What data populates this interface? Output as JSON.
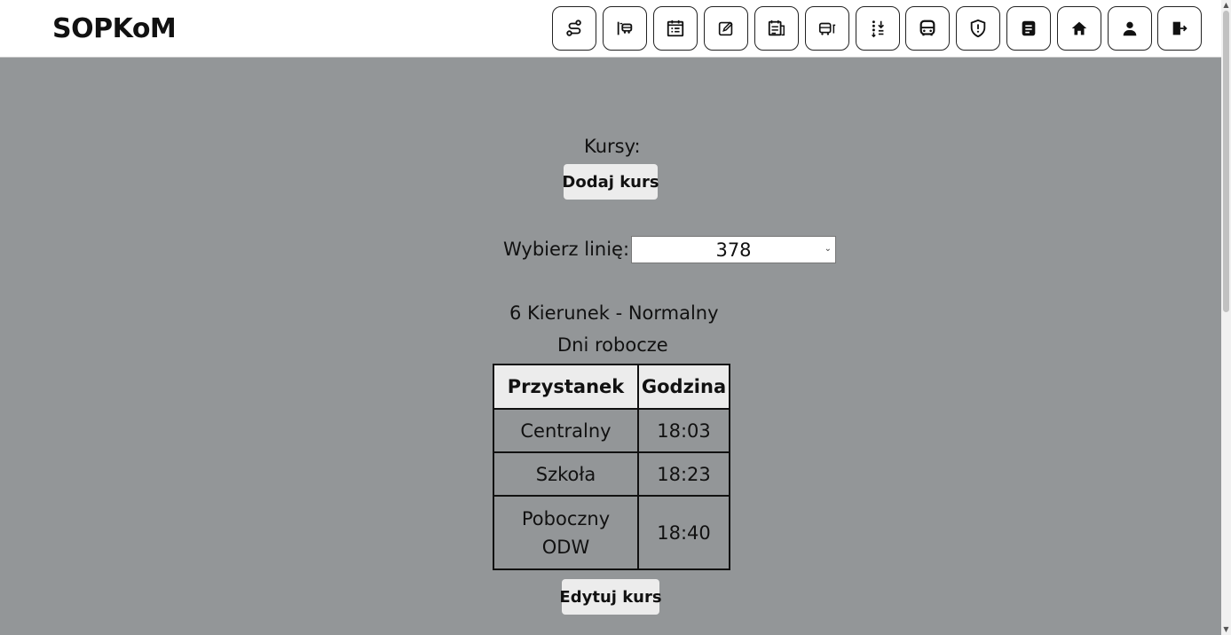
{
  "app": {
    "title": "SOPKoM"
  },
  "nav": [
    {
      "name": "nav-route-button",
      "icon": "route-icon"
    },
    {
      "name": "nav-bus-stop-button",
      "icon": "bus-stop-icon"
    },
    {
      "name": "nav-calendar-list-button",
      "icon": "calendar-list-icon"
    },
    {
      "name": "nav-edit-button",
      "icon": "edit-icon"
    },
    {
      "name": "nav-schedule-button",
      "icon": "calendar-edit-icon"
    },
    {
      "name": "nav-vehicle-button",
      "icon": "bus-side-icon"
    },
    {
      "name": "nav-sort-button",
      "icon": "sort-arrows-icon"
    },
    {
      "name": "nav-bus-button",
      "icon": "bus-front-icon"
    },
    {
      "name": "nav-security-button",
      "icon": "shield-icon"
    },
    {
      "name": "nav-notes-button",
      "icon": "document-icon"
    },
    {
      "name": "nav-home-button",
      "icon": "home-icon"
    },
    {
      "name": "nav-user-button",
      "icon": "user-icon"
    },
    {
      "name": "nav-logout-button",
      "icon": "logout-icon"
    }
  ],
  "main": {
    "courses_label": "Kursy:",
    "add_course_button": "Dodaj kurs",
    "line_select_label": "Wybierz linię:",
    "line_select_value": "378",
    "direction": "6 Kierunek - Normalny",
    "day_type": "Dni robocze",
    "table": {
      "headers": [
        "Przystanek",
        "Godzina"
      ],
      "rows": [
        {
          "stop": "Centralny",
          "time": "18:03"
        },
        {
          "stop": "Szkoła",
          "time": "18:23"
        },
        {
          "stop": "Poboczny ODW",
          "time": "18:40"
        }
      ]
    },
    "edit_course_button": "Edytuj kurs"
  },
  "colors": {
    "background": "#939698",
    "topbar": "#ffffff",
    "button": "#ececec"
  }
}
